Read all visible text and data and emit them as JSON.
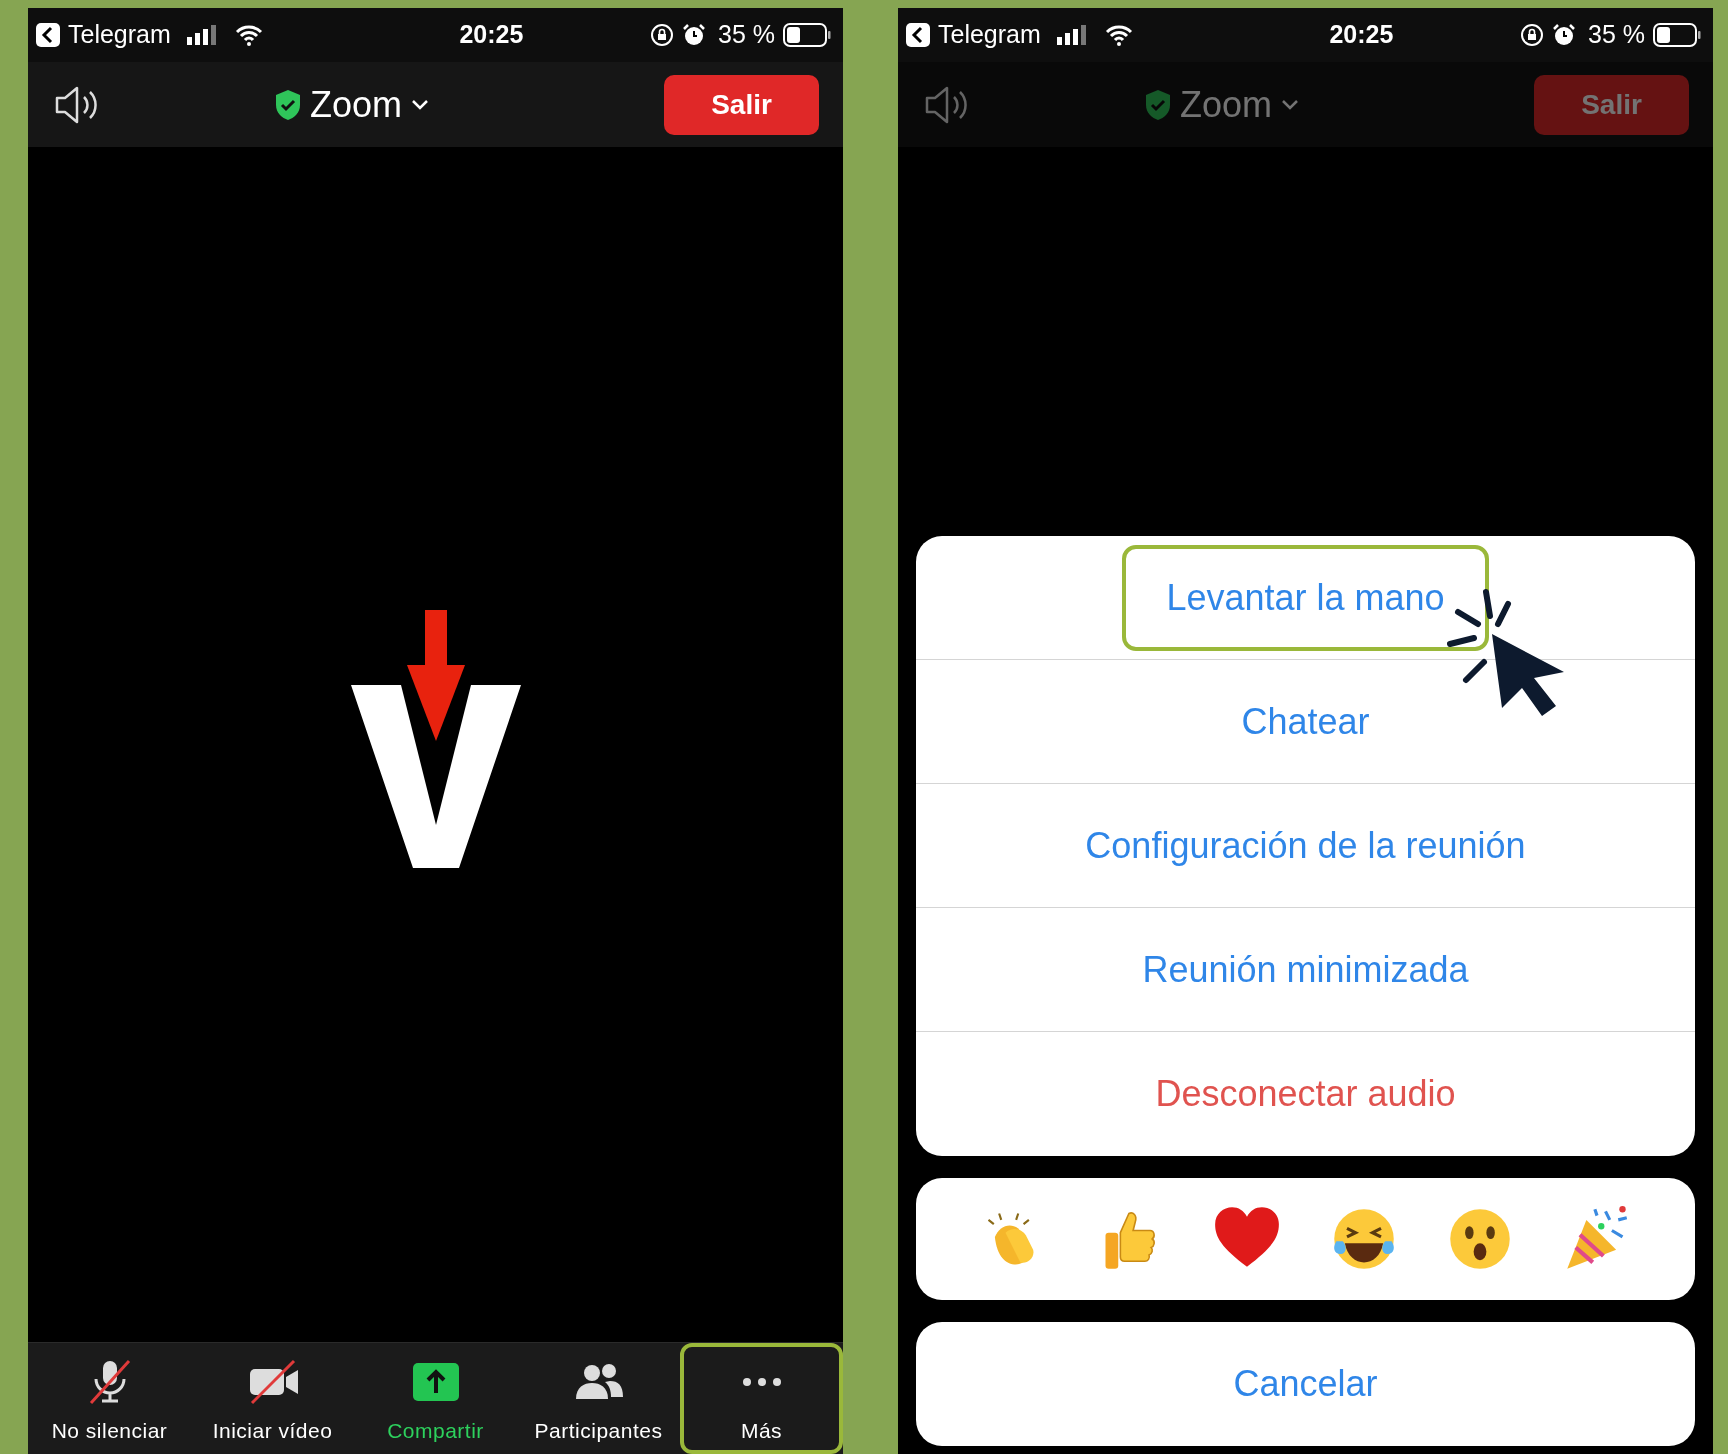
{
  "phones": [
    {
      "dimmed": false,
      "status_bar": {
        "back_app": "Telegram",
        "time": "20:25",
        "battery": "35 %"
      },
      "header": {
        "title": "Zoom",
        "leave_button": "Salir"
      },
      "toolbar": [
        {
          "label": "No silenciar",
          "kind": "mic-off",
          "highlighted": false
        },
        {
          "label": "Iniciar vídeo",
          "kind": "video-off",
          "highlighted": false
        },
        {
          "label": "Compartir",
          "kind": "share",
          "highlighted": false
        },
        {
          "label": "Participantes",
          "kind": "participants",
          "highlighted": false
        },
        {
          "label": "Más",
          "kind": "more",
          "highlighted": true
        }
      ]
    },
    {
      "dimmed": true,
      "status_bar": {
        "back_app": "Telegram",
        "time": "20:25",
        "battery": "35 %"
      },
      "header": {
        "title": "Zoom",
        "leave_button": "Salir"
      },
      "action_sheet": {
        "items": [
          {
            "label": "Levantar la mano",
            "kind": "normal",
            "highlighted": true
          },
          {
            "label": "Chatear",
            "kind": "normal",
            "highlighted": false
          },
          {
            "label": "Configuración de la reunión",
            "kind": "normal",
            "highlighted": false
          },
          {
            "label": "Reunión minimizada",
            "kind": "normal",
            "highlighted": false
          },
          {
            "label": "Desconectar audio",
            "kind": "destructive",
            "highlighted": false
          }
        ],
        "reactions": [
          {
            "kind": "clap"
          },
          {
            "kind": "thumbs-up"
          },
          {
            "kind": "heart"
          },
          {
            "kind": "laugh"
          },
          {
            "kind": "surprised"
          },
          {
            "kind": "party"
          }
        ],
        "cancel": "Cancelar"
      }
    }
  ]
}
